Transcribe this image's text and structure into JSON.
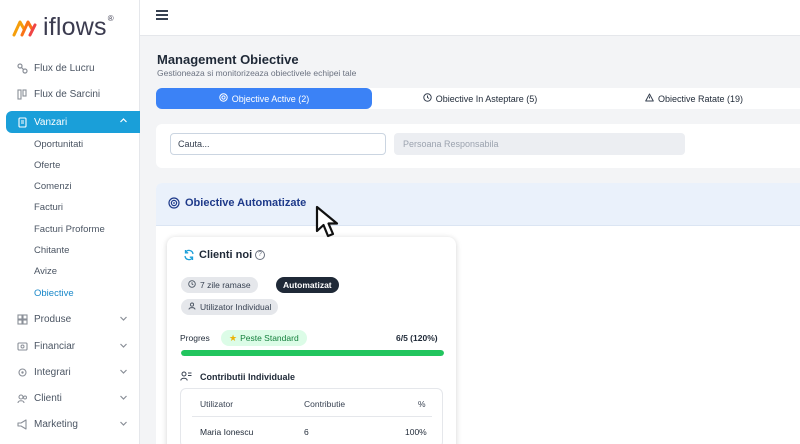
{
  "app": {
    "logo_text": "iflows",
    "logo_mark": "®"
  },
  "sidebar": {
    "items": [
      {
        "label": "Flux de Lucru",
        "icon": "flow-icon"
      },
      {
        "label": "Flux de Sarcini",
        "icon": "tasks-icon"
      },
      {
        "label": "Vanzari",
        "icon": "sales-icon",
        "active": true
      },
      {
        "label": "Produse",
        "icon": "products-icon"
      },
      {
        "label": "Financiar",
        "icon": "finance-icon"
      },
      {
        "label": "Integrari",
        "icon": "integrations-icon"
      },
      {
        "label": "Clienti",
        "icon": "clients-icon"
      },
      {
        "label": "Marketing",
        "icon": "marketing-icon"
      }
    ],
    "sub_items": [
      "Oportunitati",
      "Oferte",
      "Comenzi",
      "Facturi",
      "Facturi Proforme",
      "Chitante",
      "Avize",
      "Obiective"
    ],
    "active_sub": "Obiective"
  },
  "header": {
    "title": "Management Obiective",
    "subtitle": "Gestioneaza si monitorizeaza obiectivele echipei tale"
  },
  "tabs": [
    {
      "label": "Objective Active (2)",
      "icon": "target-icon",
      "active": true
    },
    {
      "label": "Obiective In Asteptare (5)",
      "icon": "clock-icon"
    },
    {
      "label": "Obiective Ratate (19)",
      "icon": "warning-icon"
    }
  ],
  "filters": {
    "search_placeholder": "Cauta...",
    "person_placeholder": "Persoana Responsabila"
  },
  "section": {
    "title": "Obiective Automatizate"
  },
  "card": {
    "title": "Clienti noi",
    "chips": {
      "days_left": "7 zile ramase",
      "type": "Automatizat",
      "assignee": "Utilizator Individual"
    },
    "progress": {
      "label": "Progres",
      "badge": "Peste Standard",
      "value_text": "6/5 (120%)",
      "fraction": 1.0
    },
    "contributions": {
      "title": "Contributii Individuale",
      "columns": [
        "Utilizator",
        "Contributie",
        "%"
      ],
      "rows": [
        [
          "Maria Ionescu",
          "6",
          "100%"
        ]
      ]
    }
  },
  "colors": {
    "brand_blue": "#1a9fd9",
    "tab_active": "#3b82f6",
    "progress": "#22c55e"
  }
}
